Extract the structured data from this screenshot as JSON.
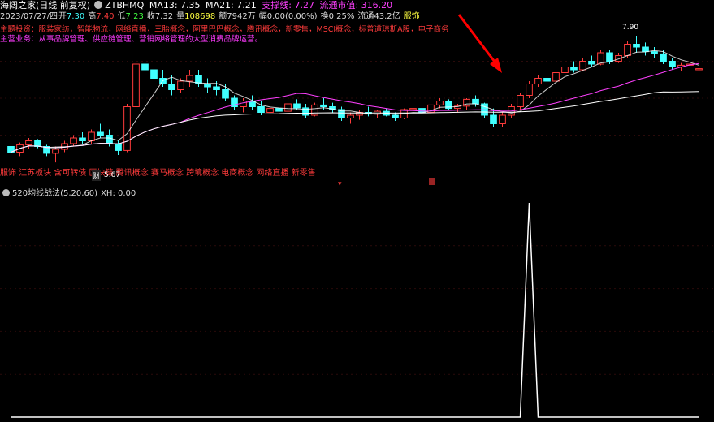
{
  "header": {
    "app_title": "海阔之家(日线 前复权)",
    "ticker": "ZTBHMQ",
    "ma13": "MA13: 7.35",
    "ma21": "MA21: 7.21",
    "support": "支撑线: 7.27",
    "float_mv": "流通市值: 316.20"
  },
  "quote": {
    "date": "2023/07/27/四",
    "open_label": "开",
    "open": "7.30",
    "high_label": "高",
    "high": "7.40",
    "low_label": "低",
    "low": "7.23",
    "close_label": "收",
    "close": "7.32",
    "volume_label": "量",
    "volume": "108698",
    "amount_label": "额",
    "amount": "7942万",
    "change_label": "幅",
    "change": "0.00(0.00%)",
    "turnover_label": "换",
    "turnover": "0.25%",
    "float_shares_label": "流通",
    "float_shares": "43.2亿",
    "industry": "服饰"
  },
  "concept_text": "主题投资：服装家纺，智能物流，网络直播，三胎概念，阿里巴巴概念，腾讯概念，新零售，MSCI概念，标普道琼斯A股，电子商务",
  "business_text": "主营业务：从事品牌管理、供应链管理、营销网络管理的大型消费品牌运营。",
  "tags_text": "服饰 江苏板块 含可转债 区块链 腾讯概念 赛马概念 跨境概念 电商概念 网络直播 新零售",
  "markers": {
    "low_price": "5.67",
    "finance_mark": "财",
    "high_price": "7.90"
  },
  "indicator": {
    "name": "520均线战法",
    "params": "(5,20,60)",
    "xh": "XH: 0.00"
  },
  "colors": {
    "up": "#ff3b3b",
    "down": "#40ffff",
    "ma5": "#ffffff",
    "ma20": "#ff40ff",
    "ma60": "#ffffff",
    "indicator_line": "#ffffff",
    "arrow": "#ff0000"
  },
  "icons": {
    "settings": "gear-icon"
  },
  "chart_data": {
    "type": "candlestick",
    "title": "海阔之家(日线 前复权)",
    "ohlc": [
      [
        5.95,
        6.05,
        5.8,
        5.85
      ],
      [
        5.85,
        6.02,
        5.78,
        5.98
      ],
      [
        5.98,
        6.1,
        5.9,
        6.05
      ],
      [
        6.05,
        6.08,
        5.92,
        5.95
      ],
      [
        5.95,
        5.98,
        5.78,
        5.83
      ],
      [
        5.83,
        5.95,
        5.67,
        5.9
      ],
      [
        5.9,
        6.05,
        5.85,
        6.0
      ],
      [
        6.0,
        6.15,
        5.95,
        6.1
      ],
      [
        6.1,
        6.2,
        6.0,
        6.05
      ],
      [
        6.05,
        6.25,
        6.0,
        6.2
      ],
      [
        6.2,
        6.35,
        6.1,
        6.15
      ],
      [
        6.15,
        6.25,
        5.95,
        6.0
      ],
      [
        6.0,
        6.05,
        5.8,
        5.88
      ],
      [
        5.88,
        6.7,
        5.85,
        6.65
      ],
      [
        6.65,
        7.45,
        6.6,
        7.4
      ],
      [
        7.4,
        7.55,
        7.2,
        7.3
      ],
      [
        7.3,
        7.45,
        7.05,
        7.15
      ],
      [
        7.15,
        7.3,
        7.0,
        7.05
      ],
      [
        7.05,
        7.2,
        6.85,
        6.95
      ],
      [
        6.95,
        7.15,
        6.9,
        7.1
      ],
      [
        7.1,
        7.3,
        7.0,
        7.2
      ],
      [
        7.2,
        7.3,
        7.0,
        7.05
      ],
      [
        7.05,
        7.15,
        6.9,
        7.0
      ],
      [
        7.0,
        7.1,
        6.85,
        6.95
      ],
      [
        6.95,
        7.05,
        6.75,
        6.8
      ],
      [
        6.8,
        6.85,
        6.6,
        6.65
      ],
      [
        6.65,
        6.8,
        6.55,
        6.75
      ],
      [
        6.75,
        6.85,
        6.6,
        6.65
      ],
      [
        6.65,
        6.75,
        6.5,
        6.55
      ],
      [
        6.55,
        6.7,
        6.5,
        6.62
      ],
      [
        6.62,
        6.68,
        6.52,
        6.57
      ],
      [
        6.57,
        6.75,
        6.55,
        6.7
      ],
      [
        6.7,
        6.78,
        6.6,
        6.63
      ],
      [
        6.63,
        6.7,
        6.45,
        6.5
      ],
      [
        6.5,
        6.72,
        6.48,
        6.68
      ],
      [
        6.68,
        6.8,
        6.6,
        6.65
      ],
      [
        6.65,
        6.72,
        6.55,
        6.6
      ],
      [
        6.6,
        6.65,
        6.4,
        6.45
      ],
      [
        6.45,
        6.55,
        6.35,
        6.5
      ],
      [
        6.5,
        6.6,
        6.42,
        6.55
      ],
      [
        6.55,
        6.65,
        6.48,
        6.52
      ],
      [
        6.52,
        6.6,
        6.45,
        6.57
      ],
      [
        6.57,
        6.62,
        6.48,
        6.5
      ],
      [
        6.5,
        6.55,
        6.4,
        6.45
      ],
      [
        6.45,
        6.62,
        6.43,
        6.6
      ],
      [
        6.6,
        6.7,
        6.55,
        6.62
      ],
      [
        6.62,
        6.68,
        6.5,
        6.55
      ],
      [
        6.55,
        6.72,
        6.52,
        6.68
      ],
      [
        6.68,
        6.8,
        6.62,
        6.75
      ],
      [
        6.75,
        6.78,
        6.58,
        6.62
      ],
      [
        6.62,
        6.7,
        6.55,
        6.66
      ],
      [
        6.66,
        6.8,
        6.6,
        6.78
      ],
      [
        6.78,
        6.85,
        6.65,
        6.7
      ],
      [
        6.7,
        6.72,
        6.45,
        6.5
      ],
      [
        6.5,
        6.62,
        6.3,
        6.35
      ],
      [
        6.35,
        6.55,
        6.3,
        6.5
      ],
      [
        6.5,
        6.7,
        6.45,
        6.65
      ],
      [
        6.65,
        6.9,
        6.6,
        6.85
      ],
      [
        6.85,
        7.1,
        6.8,
        7.05
      ],
      [
        7.05,
        7.2,
        7.0,
        7.15
      ],
      [
        7.15,
        7.25,
        7.05,
        7.1
      ],
      [
        7.1,
        7.3,
        7.05,
        7.25
      ],
      [
        7.25,
        7.4,
        7.2,
        7.35
      ],
      [
        7.35,
        7.45,
        7.25,
        7.3
      ],
      [
        7.3,
        7.5,
        7.28,
        7.45
      ],
      [
        7.45,
        7.55,
        7.35,
        7.4
      ],
      [
        7.4,
        7.65,
        7.38,
        7.6
      ],
      [
        7.6,
        7.65,
        7.4,
        7.45
      ],
      [
        7.45,
        7.6,
        7.42,
        7.55
      ],
      [
        7.55,
        7.8,
        7.5,
        7.75
      ],
      [
        7.75,
        7.9,
        7.6,
        7.7
      ],
      [
        7.7,
        7.78,
        7.55,
        7.62
      ],
      [
        7.62,
        7.7,
        7.5,
        7.58
      ],
      [
        7.58,
        7.65,
        7.4,
        7.45
      ],
      [
        7.45,
        7.5,
        7.3,
        7.35
      ],
      [
        7.35,
        7.42,
        7.28,
        7.38
      ],
      [
        7.38,
        7.45,
        7.3,
        7.4
      ],
      [
        7.3,
        7.4,
        7.23,
        7.32
      ]
    ],
    "indicator_values": [
      0,
      0,
      0,
      0,
      0,
      0,
      0,
      0,
      0,
      0,
      0,
      0,
      0,
      0,
      0,
      0,
      0,
      0,
      0,
      0,
      0,
      0,
      0,
      0,
      0,
      0,
      0,
      0,
      0,
      0,
      0,
      0,
      0,
      0,
      0,
      0,
      0,
      0,
      0,
      0,
      0,
      0,
      0,
      0,
      0,
      0,
      0,
      0,
      0,
      0,
      0,
      0,
      0,
      0,
      0,
      0,
      0,
      0,
      1,
      0,
      0,
      0,
      0,
      0,
      0,
      0,
      0,
      0,
      0,
      0,
      0,
      0,
      0,
      0,
      0,
      0,
      0,
      0
    ],
    "price_range": [
      5.5,
      8.1
    ],
    "indicator_range": [
      0,
      1
    ]
  }
}
